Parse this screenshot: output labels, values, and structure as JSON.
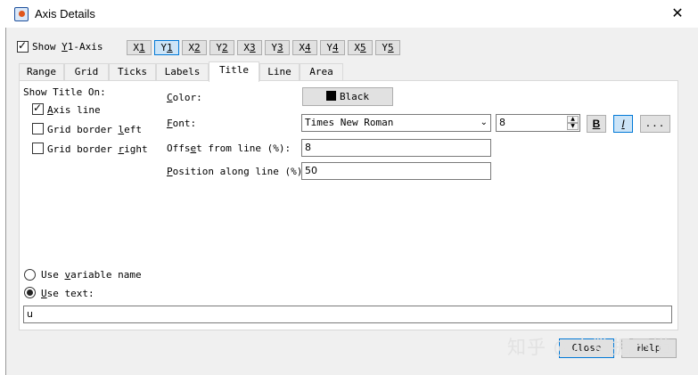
{
  "window": {
    "title": "Axis Details",
    "close_glyph": "✕"
  },
  "show_axis": {
    "label_pre": "Show ",
    "label_u": "Y",
    "label_post": "1-Axis",
    "checked": true
  },
  "axis_buttons": [
    {
      "pre": "X",
      "u": "1",
      "active": false
    },
    {
      "pre": "Y",
      "u": "1",
      "active": true
    },
    {
      "pre": "X",
      "u": "2",
      "active": false
    },
    {
      "pre": "Y",
      "u": "2",
      "active": false
    },
    {
      "pre": "X",
      "u": "3",
      "active": false
    },
    {
      "pre": "Y",
      "u": "3",
      "active": false
    },
    {
      "pre": "X",
      "u": "4",
      "active": false
    },
    {
      "pre": "Y",
      "u": "4",
      "active": false
    },
    {
      "pre": "X",
      "u": "5",
      "active": false
    },
    {
      "pre": "Y",
      "u": "5",
      "active": false
    }
  ],
  "tabs": [
    "Range",
    "Grid",
    "Ticks",
    "Labels",
    "Title",
    "Line",
    "Area"
  ],
  "active_tab": "Title",
  "show_title_on": {
    "heading": "Show Title On:",
    "axis_line": {
      "u": "A",
      "post": "xis line",
      "checked": true
    },
    "grid_left": {
      "pre": "Grid border ",
      "u": "l",
      "post": "eft",
      "checked": false
    },
    "grid_right": {
      "pre": "Grid border ",
      "u": "r",
      "post": "ight",
      "checked": false
    }
  },
  "color": {
    "label_u": "C",
    "label_post": "olor:",
    "value": "Black",
    "swatch": "#000000"
  },
  "font": {
    "label_u": "F",
    "label_post": "ont:",
    "family": "Times New Roman",
    "size": "8",
    "bold_label": "B",
    "italic_label": "I",
    "italic_active": true,
    "more_label": "..."
  },
  "offset": {
    "label_pre": "Offs",
    "label_u": "e",
    "label_post": "t from line (%):",
    "value": "8"
  },
  "position": {
    "label_u": "P",
    "label_post": "osition along line (%):",
    "value": "50"
  },
  "title_source": {
    "variable": {
      "pre": "Use ",
      "u": "v",
      "post": "ariable name",
      "selected": false
    },
    "text": {
      "u": "U",
      "post": "se text:",
      "selected": true
    },
    "text_value": "u"
  },
  "bottom": {
    "close_label": "Close",
    "help_label": "Help"
  },
  "watermark": "知乎 @小数据不懂"
}
